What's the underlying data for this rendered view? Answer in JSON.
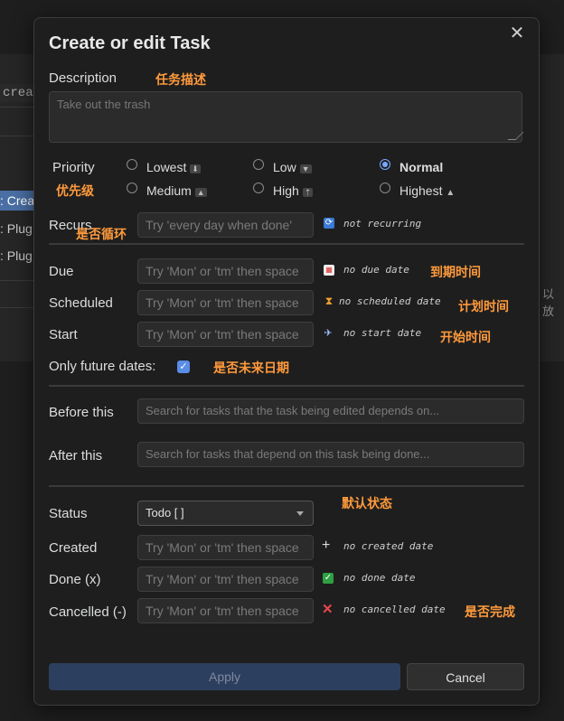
{
  "background": {
    "code_snippet": "crea",
    "items": [
      ": Crea",
      ": Plug",
      ": Plug"
    ],
    "right_text": "以放"
  },
  "dialog": {
    "title": "Create or edit Task",
    "description": {
      "label": "Description",
      "annotation": "任务描述",
      "placeholder": "Take out the trash"
    },
    "priority": {
      "label": "Priority",
      "annotation": "优先级",
      "options": [
        {
          "label": "Lowest",
          "icon": "⬇",
          "checked": false
        },
        {
          "label": "Low",
          "icon": "🔽",
          "checked": false
        },
        {
          "label": "Normal",
          "icon": "",
          "checked": true
        },
        {
          "label": "Medium",
          "icon": "🔼",
          "checked": false
        },
        {
          "label": "High",
          "icon": "⏫",
          "checked": false
        },
        {
          "label": "Highest",
          "icon": "🔺",
          "checked": false
        }
      ]
    },
    "recurs": {
      "label": "Recurs",
      "annotation": "是否循环",
      "placeholder": "Try 'every day when done'",
      "value_text": "not recurring",
      "icon": "🔁"
    },
    "due": {
      "label": "Due",
      "placeholder": "Try 'Mon' or 'tm' then space",
      "value_text": "no due date",
      "icon": "📅",
      "annotation": "到期时间"
    },
    "scheduled": {
      "label": "Scheduled",
      "placeholder": "Try 'Mon' or 'tm' then space",
      "value_text": "no scheduled date",
      "icon": "⏳",
      "annotation": "计划时间"
    },
    "start": {
      "label": "Start",
      "placeholder": "Try 'Mon' or 'tm' then space",
      "value_text": "no start date",
      "icon": "🛫",
      "annotation": "开始时间"
    },
    "future_dates": {
      "label": "Only future dates:",
      "checked": true,
      "annotation": "是否未来日期"
    },
    "before_this": {
      "label": "Before this",
      "placeholder": "Search for tasks that the task being edited depends on..."
    },
    "after_this": {
      "label": "After this",
      "placeholder": "Search for tasks that depend on this task being done..."
    },
    "status": {
      "label": "Status",
      "value": "Todo [ ]",
      "annotation": "默认状态"
    },
    "created": {
      "label": "Created",
      "placeholder": "Try 'Mon' or 'tm' then space",
      "value_text": "no created date",
      "icon": "➕"
    },
    "done": {
      "label": "Done (x)",
      "placeholder": "Try 'Mon' or 'tm' then space",
      "value_text": "no done date",
      "icon": "✅"
    },
    "cancelled": {
      "label": "Cancelled (-)",
      "placeholder": "Try 'Mon' or 'tm' then space",
      "value_text": "no cancelled date",
      "icon": "❌",
      "annotation": "是否完成"
    },
    "apply_label": "Apply",
    "cancel_label": "Cancel"
  }
}
